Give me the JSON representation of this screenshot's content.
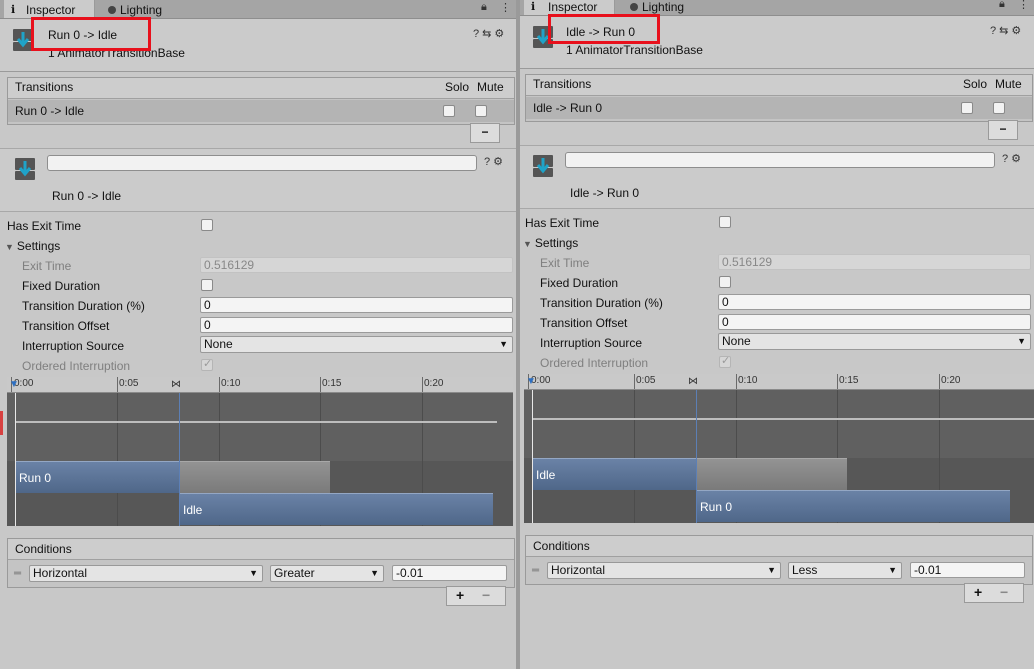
{
  "panels": [
    {
      "tabs": {
        "inspector": "Inspector",
        "lighting": "Lighting"
      },
      "header": {
        "title": "Run 0 -> Idle",
        "subtitle": "1 AnimatorTransitionBase"
      },
      "transitions": {
        "heading": "Transitions",
        "solo": "Solo",
        "mute": "Mute",
        "row": "Run 0 -> Idle",
        "remove": "−"
      },
      "transition_name": "Run 0 -> Idle",
      "settings": {
        "has_exit_time": "Has Exit Time",
        "foldout": "Settings",
        "exit_time_label": "Exit Time",
        "exit_time_value": "0.516129",
        "fixed_duration": "Fixed Duration",
        "duration_label": "Transition Duration (%)",
        "duration_value": "0",
        "offset_label": "Transition Offset",
        "offset_value": "0",
        "interruption_label": "Interruption Source",
        "interruption_value": "None",
        "ordered_label": "Ordered Interruption"
      },
      "timeline": {
        "ticks": [
          "0:00",
          "0:05",
          "0:10",
          "0:15",
          "0:20"
        ],
        "source_clip": "Run 0",
        "dest_clip": "Idle"
      },
      "conditions": {
        "heading": "Conditions",
        "parameter": "Horizontal",
        "mode": "Greater",
        "threshold": "-0.01",
        "add": "+",
        "remove": "−"
      }
    },
    {
      "tabs": {
        "inspector": "Inspector",
        "lighting": "Lighting"
      },
      "header": {
        "title": "Idle -> Run 0",
        "subtitle": "1 AnimatorTransitionBase"
      },
      "transitions": {
        "heading": "Transitions",
        "solo": "Solo",
        "mute": "Mute",
        "row": "Idle -> Run 0",
        "remove": "−"
      },
      "transition_name": "Idle -> Run 0",
      "settings": {
        "has_exit_time": "Has Exit Time",
        "foldout": "Settings",
        "exit_time_label": "Exit Time",
        "exit_time_value": "0.516129",
        "fixed_duration": "Fixed Duration",
        "duration_label": "Transition Duration (%)",
        "duration_value": "0",
        "offset_label": "Transition Offset",
        "offset_value": "0",
        "interruption_label": "Interruption Source",
        "interruption_value": "None",
        "ordered_label": "Ordered Interruption"
      },
      "timeline": {
        "ticks": [
          "0:00",
          "0:05",
          "0:10",
          "0:15",
          "0:20"
        ],
        "source_clip": "Idle",
        "dest_clip": "Run 0"
      },
      "conditions": {
        "heading": "Conditions",
        "parameter": "Horizontal",
        "mode": "Less",
        "threshold": "-0.01",
        "add": "+",
        "remove": "−"
      }
    }
  ],
  "icons": [
    "info-icon",
    "lighting-dot-icon",
    "lock-icon",
    "menu-icon",
    "animator-transition-icon",
    "help-icon",
    "presets-icon",
    "settings-icon",
    "checkbox-icon",
    "dropdown-arrow-icon",
    "foldout-arrow-icon",
    "drag-handle-icon",
    "playhead-marker-icon"
  ],
  "colors": {
    "highlight_box": "#e8101c",
    "clip_blue": "#5a7398",
    "clip_gray": "#878787",
    "timeline_bg": "#575757"
  }
}
